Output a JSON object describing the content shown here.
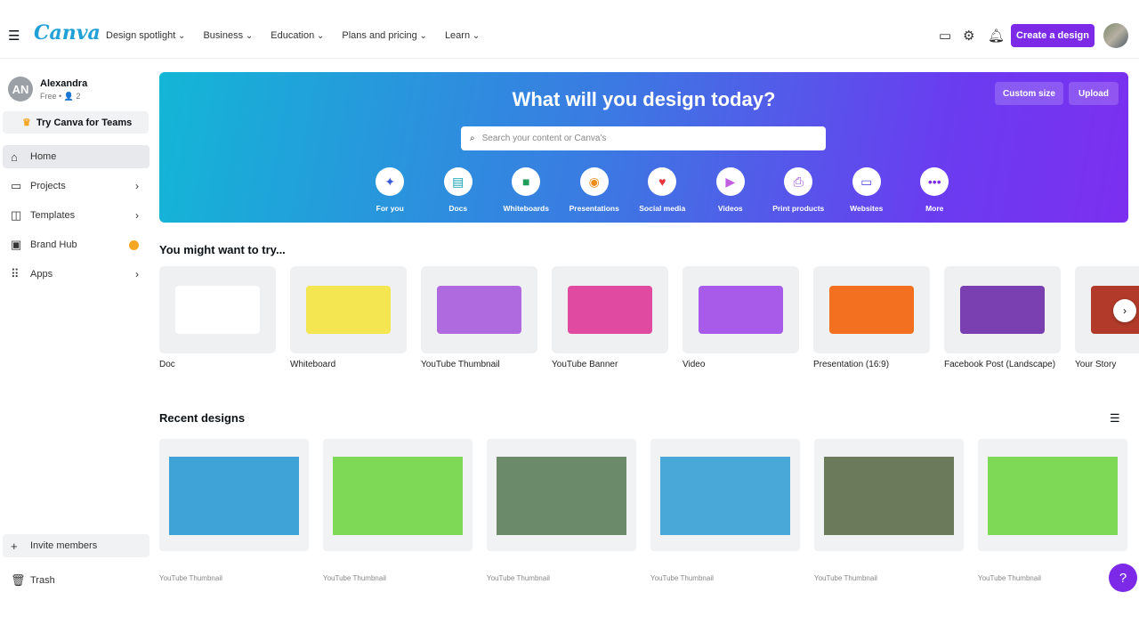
{
  "header": {
    "logo": "Canva",
    "nav": [
      "Design spotlight",
      "Business",
      "Education",
      "Plans and pricing",
      "Learn"
    ],
    "create_label": "Create a design",
    "accent": "#7d2ae8"
  },
  "user": {
    "initials": "AN",
    "name": "Alexandra",
    "plan": "Free • 👤 2",
    "teams_label": "Try Canva for Teams"
  },
  "sidebar": {
    "items": [
      {
        "label": "Home",
        "icon": "home-icon"
      },
      {
        "label": "Projects",
        "icon": "folder-icon"
      },
      {
        "label": "Templates",
        "icon": "template-icon"
      },
      {
        "label": "Brand Hub",
        "icon": "brand-icon"
      },
      {
        "label": "Apps",
        "icon": "grid-icon"
      }
    ],
    "invite": "Invite members",
    "trash": "Trash"
  },
  "hero": {
    "title": "What will you design today?",
    "custom_size": "Custom size",
    "upload": "Upload",
    "search_placeholder": "Search your content or Canva's",
    "categories": [
      {
        "label": "For you",
        "icon": "✦",
        "color": "#3a5bd9"
      },
      {
        "label": "Docs",
        "icon": "▤",
        "color": "#13a3b5"
      },
      {
        "label": "Whiteboards",
        "icon": "■",
        "color": "#1e9e5a"
      },
      {
        "label": "Presentations",
        "icon": "◉",
        "color": "#f08c1a"
      },
      {
        "label": "Social media",
        "icon": "♥",
        "color": "#e8333a"
      },
      {
        "label": "Videos",
        "icon": "▶",
        "color": "#c25ee0"
      },
      {
        "label": "Print products",
        "icon": "⎙",
        "color": "#a04ee0"
      },
      {
        "label": "Websites",
        "icon": "▭",
        "color": "#5a4ee0"
      },
      {
        "label": "More",
        "icon": "•••",
        "color": "#7d2ae8"
      }
    ]
  },
  "try": {
    "title": "You might want to try...",
    "items": [
      {
        "label": "Doc",
        "bg": "#ffffff"
      },
      {
        "label": "Whiteboard",
        "bg": "#f4e650"
      },
      {
        "label": "YouTube Thumbnail",
        "bg": "#b06ae0"
      },
      {
        "label": "YouTube Banner",
        "bg": "#e04aa0"
      },
      {
        "label": "Video",
        "bg": "#a85be8"
      },
      {
        "label": "Presentation (16:9)",
        "bg": "#f2701f"
      },
      {
        "label": "Facebook Post (Landscape)",
        "bg": "#7a3fb0"
      },
      {
        "label": "Your Story",
        "bg": "#b23a2a"
      }
    ]
  },
  "recent": {
    "title": "Recent designs",
    "items": [
      {
        "label": "YouTube Thumbnail",
        "bg": "#3fa3d8"
      },
      {
        "label": "YouTube Thumbnail",
        "bg": "#7ed957"
      },
      {
        "label": "YouTube Thumbnail",
        "bg": "#6a8a6a"
      },
      {
        "label": "YouTube Thumbnail",
        "bg": "#4aa8d8"
      },
      {
        "label": "YouTube Thumbnail",
        "bg": "#6a7a5a"
      },
      {
        "label": "YouTube Thumbnail",
        "bg": "#7ed957"
      }
    ]
  },
  "help": "?"
}
